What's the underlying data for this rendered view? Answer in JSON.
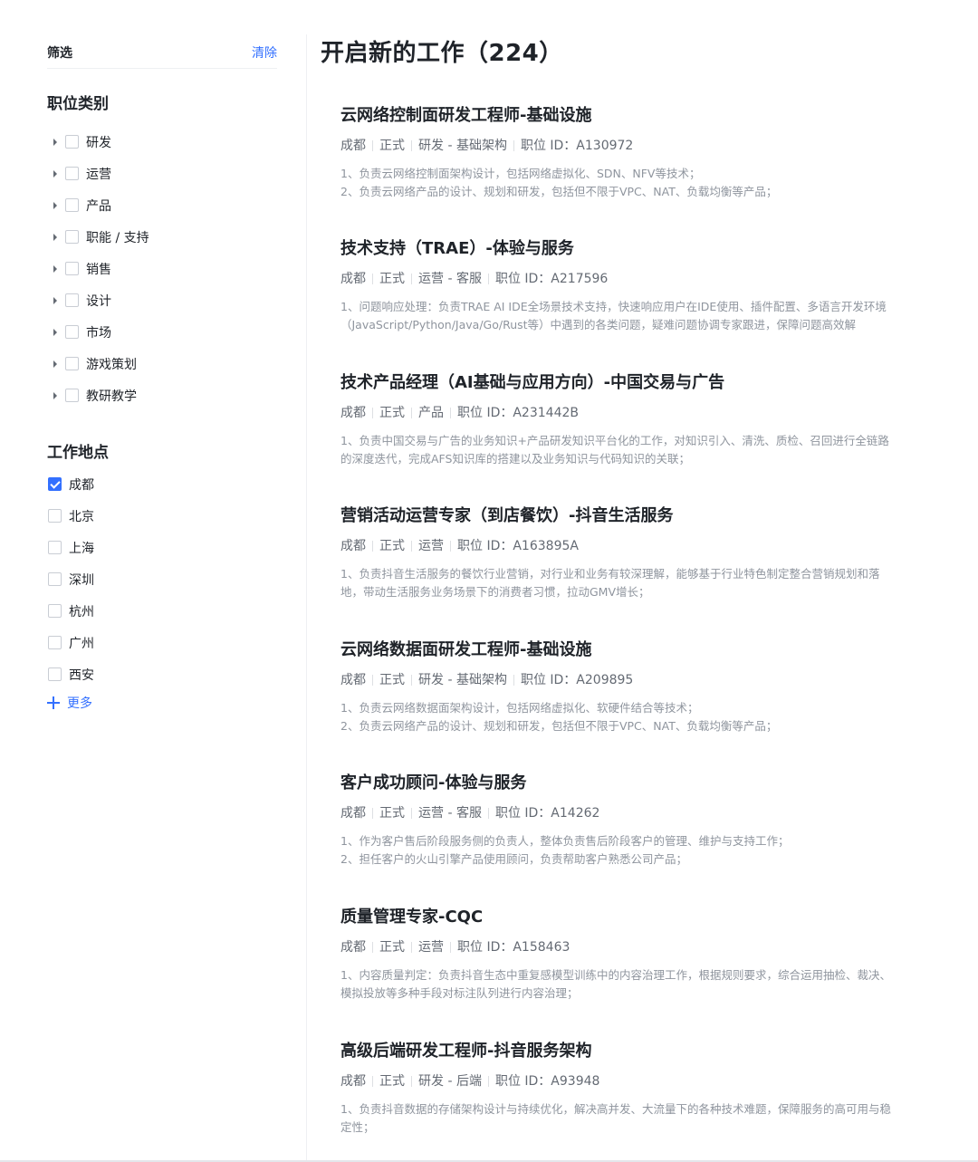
{
  "filter": {
    "title": "筛选",
    "clear_label": "清除"
  },
  "categories": {
    "title": "职位类别",
    "items": [
      {
        "label": "研发"
      },
      {
        "label": "运营"
      },
      {
        "label": "产品"
      },
      {
        "label": "职能 / 支持"
      },
      {
        "label": "销售"
      },
      {
        "label": "设计"
      },
      {
        "label": "市场"
      },
      {
        "label": "游戏策划"
      },
      {
        "label": "教研教学"
      }
    ]
  },
  "locations": {
    "title": "工作地点",
    "items": [
      {
        "label": "成都",
        "checked": true
      },
      {
        "label": "北京",
        "checked": false
      },
      {
        "label": "上海",
        "checked": false
      },
      {
        "label": "深圳",
        "checked": false
      },
      {
        "label": "杭州",
        "checked": false
      },
      {
        "label": "广州",
        "checked": false
      },
      {
        "label": "西安",
        "checked": false
      }
    ],
    "more_label": "更多"
  },
  "main": {
    "title": "开启新的工作（224）",
    "jobs": [
      {
        "title": "云网络控制面研发工程师-基础设施",
        "meta": [
          "成都",
          "正式",
          "研发 - 基础架构",
          "职位 ID：A130972"
        ],
        "desc": [
          "1、负责云网络控制面架构设计，包括网络虚拟化、SDN、NFV等技术；",
          "2、负责云网络产品的设计、规划和研发，包括但不限于VPC、NAT、负载均衡等产品；"
        ]
      },
      {
        "title": "技术支持（TRAE）-体验与服务",
        "meta": [
          "成都",
          "正式",
          "运营 - 客服",
          "职位 ID：A217596"
        ],
        "desc": [
          "1、问题响应处理：负责TRAE AI IDE全场景技术支持，快速响应用户在IDE使用、插件配置、多语言开发环境（JavaScript/Python/Java/Go/Rust等）中遇到的各类问题，疑难问题协调专家跟进，保障问题高效解"
        ]
      },
      {
        "title": "技术产品经理（AI基础与应用方向）-中国交易与广告",
        "meta": [
          "成都",
          "正式",
          "产品",
          "职位 ID：A231442B"
        ],
        "desc": [
          "1、负责中国交易与广告的业务知识+产品研发知识平台化的工作，对知识引入、清洗、质检、召回进行全链路的深度迭代，完成AFS知识库的搭建以及业务知识与代码知识的关联；"
        ]
      },
      {
        "title": "营销活动运营专家（到店餐饮）-抖音生活服务",
        "meta": [
          "成都",
          "正式",
          "运营",
          "职位 ID：A163895A"
        ],
        "desc": [
          "1、负责抖音生活服务的餐饮行业营销，对行业和业务有较深理解，能够基于行业特色制定整合营销规划和落地，带动生活服务业务场景下的消费者习惯，拉动GMV增长；"
        ]
      },
      {
        "title": "云网络数据面研发工程师-基础设施",
        "meta": [
          "成都",
          "正式",
          "研发 - 基础架构",
          "职位 ID：A209895"
        ],
        "desc": [
          "1、负责云网络数据面架构设计，包括网络虚拟化、软硬件结合等技术；",
          "2、负责云网络产品的设计、规划和研发，包括但不限于VPC、NAT、负载均衡等产品；"
        ]
      },
      {
        "title": "客户成功顾问-体验与服务",
        "meta": [
          "成都",
          "正式",
          "运营 - 客服",
          "职位 ID：A14262"
        ],
        "desc": [
          "1、作为客户售后阶段服务侧的负责人，整体负责售后阶段客户的管理、维护与支持工作；",
          "2、担任客户的火山引擎产品使用顾问，负责帮助客户熟悉公司产品；"
        ]
      },
      {
        "title": "质量管理专家-CQC",
        "meta": [
          "成都",
          "正式",
          "运营",
          "职位 ID：A158463"
        ],
        "desc": [
          "1、内容质量判定：负责抖音生态中重复感模型训练中的内容治理工作，根据规则要求，综合运用抽检、裁决、模拟投放等多种手段对标注队列进行内容治理；"
        ]
      },
      {
        "title": "高级后端研发工程师-抖音服务架构",
        "meta": [
          "成都",
          "正式",
          "研发 - 后端",
          "职位 ID：A93948"
        ],
        "desc": [
          "1、负责抖音数据的存储架构设计与持续优化，解决高并发、大流量下的各种技术难题，保障服务的高可用与稳定性；"
        ]
      }
    ]
  }
}
